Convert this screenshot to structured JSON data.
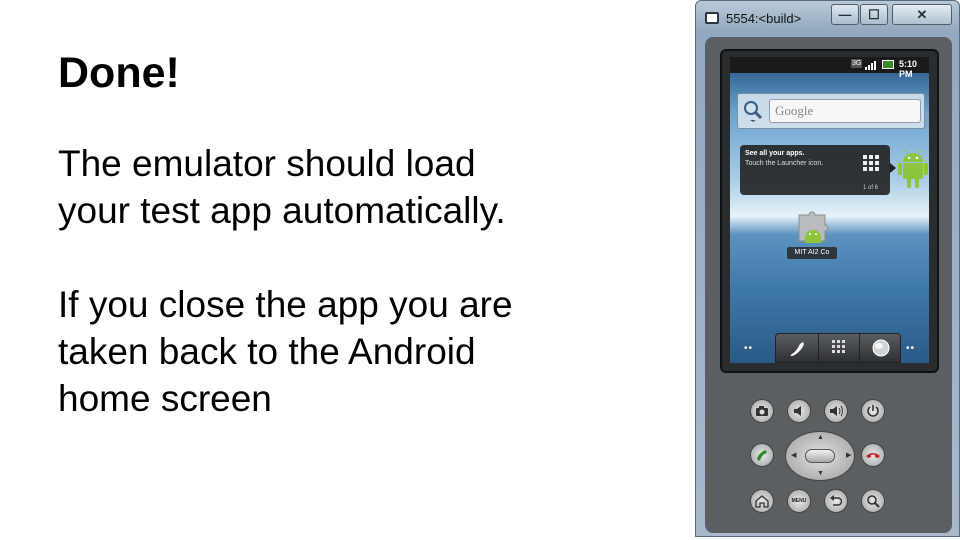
{
  "slide": {
    "title": "Done!",
    "lines": [
      "The emulator should load",
      "your test app automatically.",
      "If you close the app you are",
      "taken back to the Android",
      "home screen"
    ]
  },
  "emulator": {
    "window_title": "5554:<build>",
    "controls": {
      "minimize": "—",
      "maximize": "☐",
      "close": "✕"
    },
    "status_bar": {
      "network": "3G",
      "time": "5:10 PM"
    },
    "search_widget": {
      "placeholder": "Google"
    },
    "launcher_tip": {
      "title": "See all your apps.",
      "subtitle": "Touch the Launcher icon.",
      "count": "1 of 6"
    },
    "app_shortcut": {
      "label": "MIT AI2 Co"
    },
    "dock": {
      "dots_left": "••",
      "dots_right": "••"
    },
    "hardware": {
      "menu_label": "MENU"
    }
  }
}
